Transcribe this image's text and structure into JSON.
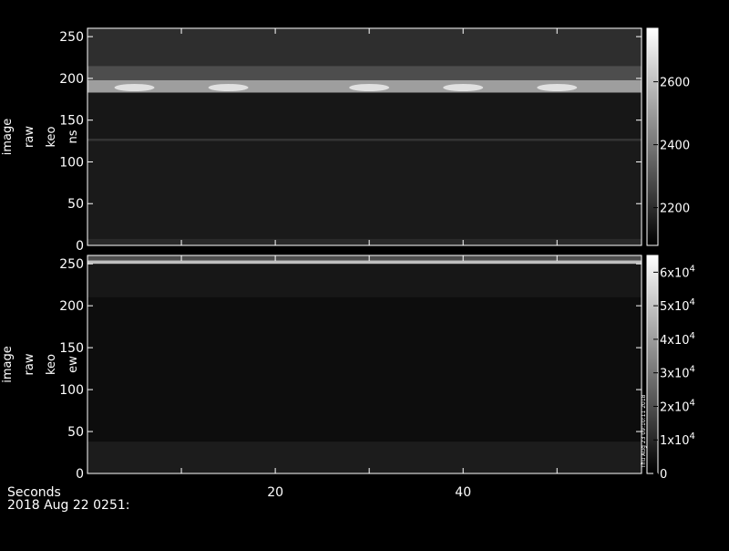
{
  "figure": {
    "background": "#000000",
    "foreground": "#ffffff",
    "x_axis_title": "Seconds",
    "date_label": "2018 Aug 22 0251:",
    "x_ticks": [
      {
        "value": 20,
        "label": "20"
      },
      {
        "value": 40,
        "label": "40"
      }
    ],
    "x_range": [
      0,
      59
    ]
  },
  "chart_data": [
    {
      "type": "heatmap",
      "ylabel": [
        "image",
        "raw",
        "keo",
        "ns"
      ],
      "xlim": [
        0,
        59
      ],
      "ylim": [
        0,
        260
      ],
      "y_ticks": [
        {
          "value": 0,
          "label": "0"
        },
        {
          "value": 50,
          "label": "50"
        },
        {
          "value": 100,
          "label": "100"
        },
        {
          "value": 150,
          "label": "150"
        },
        {
          "value": 200,
          "label": "200"
        },
        {
          "value": 250,
          "label": "250"
        }
      ],
      "colorbar": {
        "range": [
          2080,
          2770
        ],
        "ticks": [
          {
            "value": 2200,
            "label": "2200"
          },
          {
            "value": 2400,
            "label": "2400"
          },
          {
            "value": 2600,
            "label": "2600"
          }
        ]
      },
      "colormap": "grayscale",
      "bands": [
        {
          "y0": 0,
          "y1": 8,
          "level": 0.16
        },
        {
          "y0": 8,
          "y1": 125,
          "level": 0.1
        },
        {
          "y0": 125,
          "y1": 128,
          "level": 0.2
        },
        {
          "y0": 128,
          "y1": 183,
          "level": 0.09
        },
        {
          "y0": 183,
          "y1": 198,
          "level": 0.62
        },
        {
          "y0": 198,
          "y1": 215,
          "level": 0.3
        },
        {
          "y0": 215,
          "y1": 260,
          "level": 0.18
        }
      ],
      "bright_spots_x": [
        5,
        15,
        30,
        40,
        50
      ]
    },
    {
      "type": "heatmap",
      "ylabel": [
        "image",
        "raw",
        "keo",
        "ew"
      ],
      "xlim": [
        0,
        59
      ],
      "ylim": [
        0,
        260
      ],
      "y_ticks": [
        {
          "value": 0,
          "label": "0"
        },
        {
          "value": 50,
          "label": "50"
        },
        {
          "value": 100,
          "label": "100"
        },
        {
          "value": 150,
          "label": "150"
        },
        {
          "value": 200,
          "label": "200"
        },
        {
          "value": 250,
          "label": "250"
        }
      ],
      "colorbar": {
        "range": [
          0,
          65000
        ],
        "ticks": [
          {
            "value": 0,
            "label": "0",
            "mantissa": "0",
            "exponent": ""
          },
          {
            "value": 10000,
            "label": "1x10^4",
            "mantissa": "1x10",
            "exponent": "4"
          },
          {
            "value": 20000,
            "label": "2x10^4",
            "mantissa": "2x10",
            "exponent": "4"
          },
          {
            "value": 30000,
            "label": "3x10^4",
            "mantissa": "3x10",
            "exponent": "4"
          },
          {
            "value": 40000,
            "label": "4x10^4",
            "mantissa": "4x10",
            "exponent": "4"
          },
          {
            "value": 50000,
            "label": "5x10^4",
            "mantissa": "5x10",
            "exponent": "4"
          },
          {
            "value": 60000,
            "label": "6x10^4",
            "mantissa": "6x10",
            "exponent": "4"
          }
        ]
      },
      "colormap": "grayscale",
      "bands": [
        {
          "y0": 0,
          "y1": 38,
          "level": 0.11
        },
        {
          "y0": 38,
          "y1": 210,
          "level": 0.05
        },
        {
          "y0": 210,
          "y1": 250,
          "level": 0.09
        },
        {
          "y0": 250,
          "y1": 254,
          "level": 0.75
        },
        {
          "y0": 254,
          "y1": 260,
          "level": 0.3
        }
      ],
      "side_note": "Thu Aug 23 09:10:11 2018"
    }
  ]
}
